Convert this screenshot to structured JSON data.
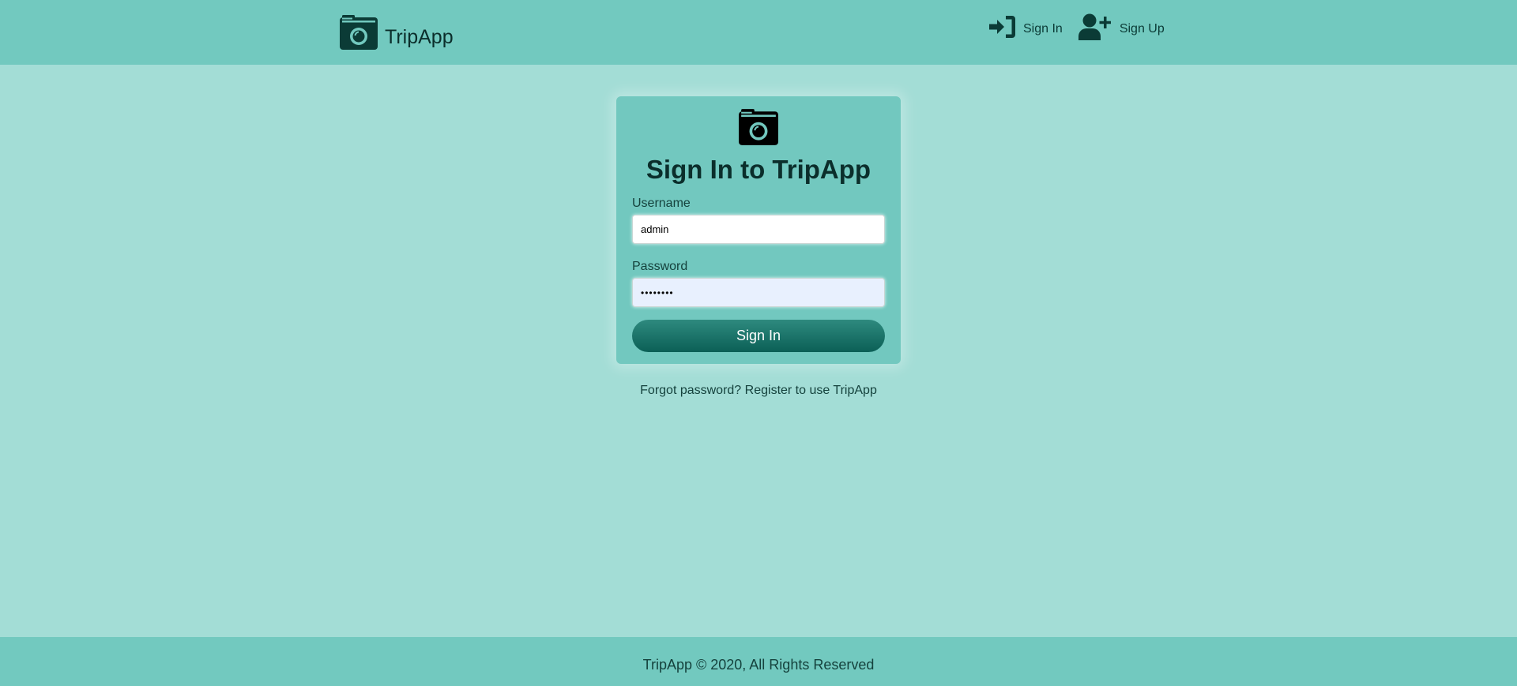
{
  "navbar": {
    "brand_icon": "camera-icon",
    "brand_name": "TripApp",
    "links": [
      {
        "icon": "sign-in-icon",
        "label": "Sign In"
      },
      {
        "icon": "user-plus-icon",
        "label": "Sign Up"
      }
    ]
  },
  "login_card": {
    "icon": "camera-icon",
    "title": "Sign In to TripApp",
    "username_label": "Username",
    "username_value": "admin",
    "password_label": "Password",
    "password_value": "••••••••",
    "submit_label": "Sign In"
  },
  "help_links": {
    "forgot": "Forgot password?",
    "register": "Register to use TripApp"
  },
  "footer": {
    "text": "TripApp © 2020, All Rights Reserved"
  },
  "colors": {
    "page_background": "#a3ddd6",
    "navbar_background": "#72c9bf",
    "card_background": "#72c8bf",
    "button_background": "#0b5f56",
    "text_dark": "#0b2e2b"
  }
}
